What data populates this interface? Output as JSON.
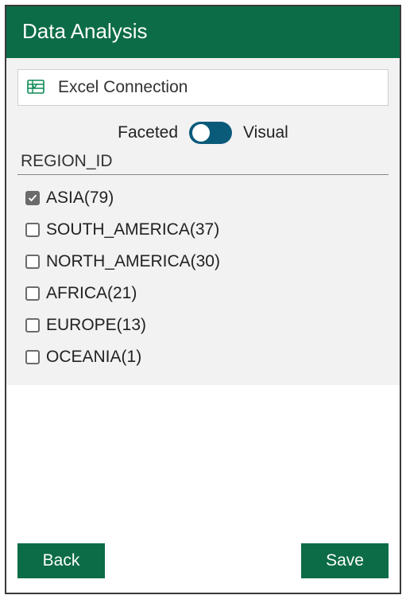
{
  "header": {
    "title": "Data Analysis"
  },
  "connection": {
    "label": "Excel Connection",
    "icon": "excel-sheet-icon"
  },
  "view_toggle": {
    "left_label": "Faceted",
    "right_label": "Visual",
    "state": "faceted"
  },
  "facet": {
    "title": "REGION_ID",
    "items": [
      {
        "label": "ASIA(79)",
        "checked": true
      },
      {
        "label": "SOUTH_AMERICA(37)",
        "checked": false
      },
      {
        "label": "NORTH_AMERICA(30)",
        "checked": false
      },
      {
        "label": "AFRICA(21)",
        "checked": false
      },
      {
        "label": "EUROPE(13)",
        "checked": false
      },
      {
        "label": "OCEANIA(1)",
        "checked": false
      }
    ]
  },
  "footer": {
    "back_label": "Back",
    "save_label": "Save"
  },
  "colors": {
    "brand_green": "#0c6c47",
    "toggle_blue": "#0a5a7a"
  }
}
